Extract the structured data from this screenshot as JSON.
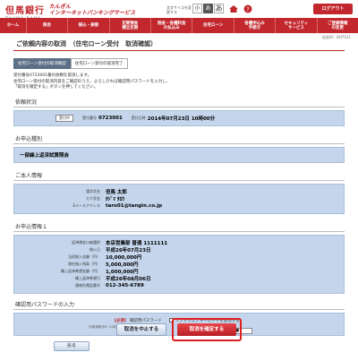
{
  "header": {
    "bank_name_jp": "但馬銀行",
    "bank_name_en": "TAJIMA BANK",
    "service_line1": "たんぎん",
    "service_line2": "インターネットバンキングサービス",
    "font_size_label": "文字サイズを変更する",
    "font_sizes": [
      "小",
      "あ",
      "あ"
    ],
    "logout_label": "ログアウト",
    "home_icon": "home-icon",
    "help_icon": "help-icon",
    "accent_color": "#c2272d"
  },
  "nav": {
    "items": [
      "ホーム",
      "照会",
      "振込・振替",
      "定期預金\n積立定期",
      "税金・各種料金\nの払込み",
      "住宅ローン",
      "各種申込み\n手続き",
      "セキュリティ\nサービス",
      "ご登録情報\nの変更"
    ]
  },
  "subinfo": "画面ID：BHT011",
  "page": {
    "title": "ご依頼内容の取消　（住宅ローン受付　取消確認）",
    "steps": [
      "住宅ローン受付の取消確認",
      "住宅ローン受付の取消完了"
    ],
    "lead_lines": [
      "受付番号0723001番の依頼を取消します。",
      "住宅ローン受付の取消内容をご確認のうえ、よろしければ確認用パスワードを入力し、",
      "「取消を確定する」ボタンを押してください。"
    ]
  },
  "status_section": {
    "title": "依頼状況",
    "badge": "受付中",
    "receipt_no_label": "受付番号",
    "receipt_no": "0723001",
    "receipt_date_label": "受付日時",
    "receipt_date": "2014年07月23日 10時00分"
  },
  "type_section": {
    "title": "お申込種別",
    "value": "一部繰上返済試算照会"
  },
  "personal_section": {
    "title": "ご本人情報",
    "rows": [
      {
        "label": "漢字氏名",
        "value": "但馬 太郎"
      },
      {
        "label": "カナ氏名",
        "value": "ﾀｼﾞﾏ ﾀﾛｳ"
      },
      {
        "label": "Eメールアドレス",
        "value": "taro01@tangin.co.jp"
      }
    ]
  },
  "application_section": {
    "title": "お申込情報１",
    "rows": [
      {
        "label": "返済預金口座選択",
        "value": "本店営業部 普通 1111111"
      },
      {
        "label": "借入日",
        "value": "平成26年07月23日"
      },
      {
        "label": "当初借入金額（円）",
        "value": "10,000,000円"
      },
      {
        "label": "現在借入残高（円）",
        "value": "5,000,000円"
      },
      {
        "label": "繰上返済希望金額（円）",
        "value": "1,000,000円"
      },
      {
        "label": "繰上返済希望日",
        "value": "平成26年08月06日"
      },
      {
        "label": "連絡先電話番号",
        "value": "012-345-6789"
      }
    ]
  },
  "auth_section": {
    "title": "確認用パスワードの入力",
    "required": "[必須]",
    "label": "確認用パスワード",
    "note": "（半角英数字6～12桁）",
    "keyboard_label": "ソフトウェアキーボードを使用する。",
    "password_mask": "●●●●●●●●"
  },
  "buttons": {
    "cancel": "取消を中止する",
    "confirm": "取消を確定する",
    "back": "戻る"
  }
}
